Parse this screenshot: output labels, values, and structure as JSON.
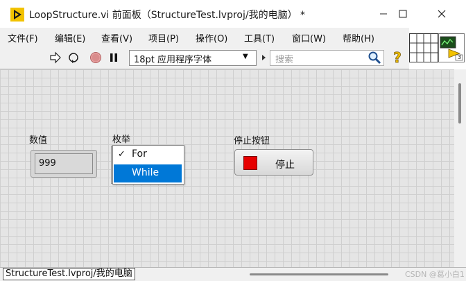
{
  "window": {
    "title": "LoopStructure.vi 前面板（StructureTest.lvproj/我的电脑） *"
  },
  "menu": {
    "items": [
      {
        "label": "文件(F)"
      },
      {
        "label": "编辑(E)"
      },
      {
        "label": "查看(V)"
      },
      {
        "label": "项目(P)"
      },
      {
        "label": "操作(O)"
      },
      {
        "label": "工具(T)"
      },
      {
        "label": "窗口(W)"
      },
      {
        "label": "帮助(H)"
      }
    ]
  },
  "toolbar": {
    "font_select": "18pt 应用程序字体",
    "search_placeholder": "搜索"
  },
  "controls": {
    "numeric": {
      "label": "数值",
      "value": "999"
    },
    "enum": {
      "label": "枚举",
      "options": [
        "For",
        "While"
      ],
      "checked": "For",
      "highlighted": "While"
    },
    "stop_button": {
      "label": "停止按钮",
      "text": "停止"
    }
  },
  "status": {
    "path": "StructureTest.lvproj/我的电脑"
  },
  "watermark": "CSDN @葛小白1",
  "icons": {
    "vi_icon_number": "3"
  },
  "colors": {
    "stop_led": "#e60000",
    "enum_highlight": "#0078d7",
    "labview_yellow": "#f2c200"
  }
}
